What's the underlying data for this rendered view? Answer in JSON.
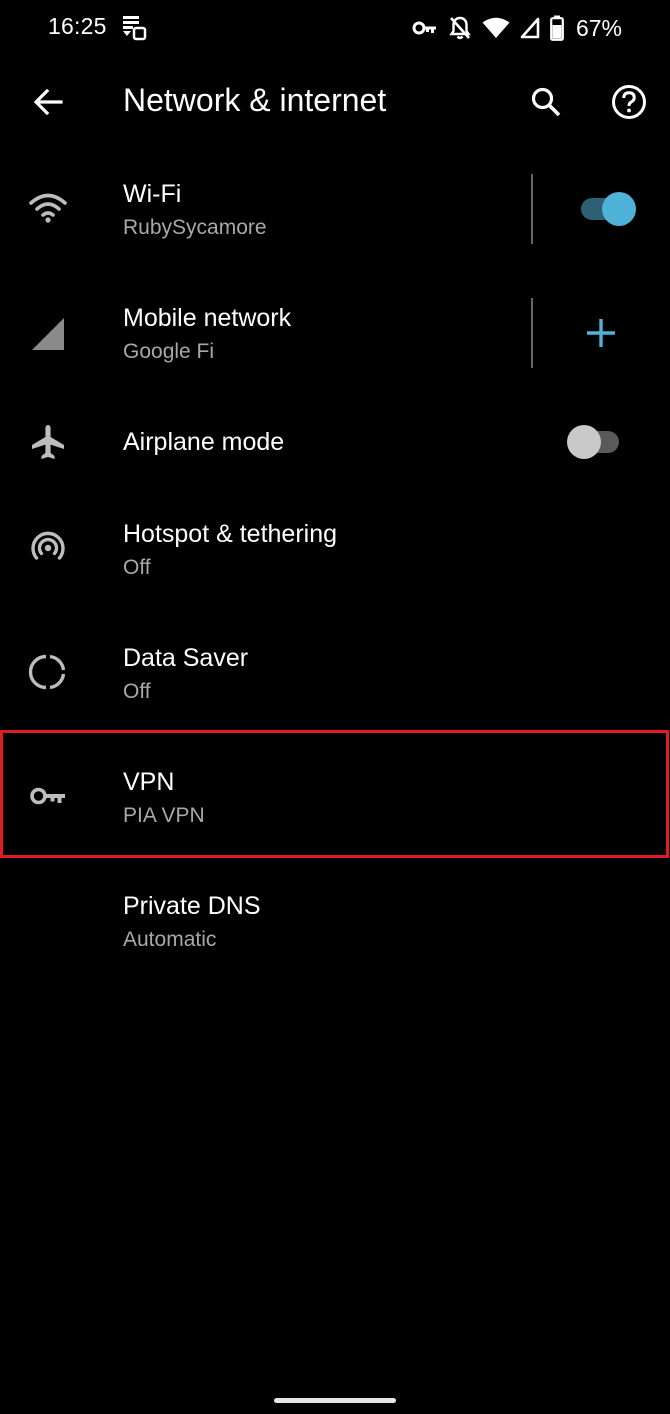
{
  "status_bar": {
    "time": "16:25",
    "battery_percent": "67%",
    "icons": [
      "notification-icon",
      "vpn-key-icon",
      "do-not-disturb-icon",
      "wifi-icon",
      "cell-signal-icon",
      "battery-icon"
    ]
  },
  "app_bar": {
    "title": "Network & internet",
    "icons": [
      "back-arrow-icon",
      "search-icon",
      "help-icon"
    ]
  },
  "settings": {
    "wifi": {
      "title": "Wi-Fi",
      "summary": "RubySycamore",
      "toggle_on": true,
      "icon": "wifi-icon"
    },
    "mobile": {
      "title": "Mobile network",
      "summary": "Google Fi",
      "icon": "cell-signal-icon",
      "action_icon": "add-icon"
    },
    "airplane": {
      "title": "Airplane mode",
      "toggle_on": false,
      "icon": "airplane-icon"
    },
    "hotspot": {
      "title": "Hotspot & tethering",
      "summary": "Off",
      "icon": "hotspot-icon"
    },
    "data_saver": {
      "title": "Data Saver",
      "summary": "Off",
      "icon": "data-saver-icon"
    },
    "vpn": {
      "title": "VPN",
      "summary": "PIA VPN",
      "icon": "vpn-key-icon",
      "highlighted": true
    },
    "private_dns": {
      "title": "Private DNS",
      "summary": "Automatic"
    }
  },
  "colors": {
    "background": "#000000",
    "accent": "#4fb3d9",
    "accent_track": "#2e5f73",
    "highlight": "#e01b24",
    "summary_text": "#a8a8a8"
  }
}
